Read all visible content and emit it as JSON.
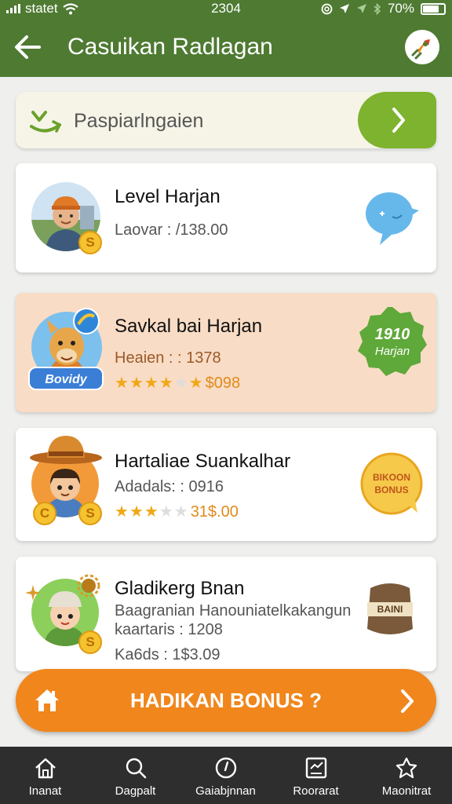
{
  "status_bar": {
    "carrier": "statet",
    "time": "2304",
    "battery": "70%"
  },
  "app_bar": {
    "title": "Casuikan Radlagan"
  },
  "banner": {
    "label": "Paspiarlngaien"
  },
  "cards": [
    {
      "title": "Level Harjan",
      "subtitle": "Laovar : /138.00"
    },
    {
      "title": "Savkal bai Harjan",
      "subtitle": "Heaien : : 1378",
      "rating": 4,
      "reward": "$098",
      "avatar_badge": "Bovidy",
      "side_badge": [
        "1910",
        "Harjan"
      ]
    },
    {
      "title": "Hartaliae Suankalhar",
      "subtitle": "Adadals: : 0916",
      "rating": 3,
      "reward": "31$.00",
      "side_badge": [
        "Bikoon",
        "Bonus"
      ]
    },
    {
      "title": "Gladikerg Bnan",
      "subtitle": "Baagranian Hanouniatelkakangun",
      "line3": "kaartaris : 1208",
      "line4": "Ka6ds : 1$3.09",
      "side_badge": [
        "Baini"
      ]
    }
  ],
  "bonus_button": {
    "label": "HADIKAN BONUS ?"
  },
  "tabs": [
    {
      "label": "Inanat",
      "icon": "home-icon"
    },
    {
      "label": "Dagpalt",
      "icon": "search-icon"
    },
    {
      "label": "Gaiabjnnan",
      "icon": "clock-icon"
    },
    {
      "label": "Roorarat",
      "icon": "report-icon"
    },
    {
      "label": "Maonitrat",
      "icon": "trophy-icon"
    }
  ],
  "colors": {
    "primary": "#4e7a32",
    "accent": "#f0861c",
    "highlight_card": "#f9dcc5",
    "banner_go": "#7db32f",
    "tab_bar": "#2e2e2e"
  }
}
